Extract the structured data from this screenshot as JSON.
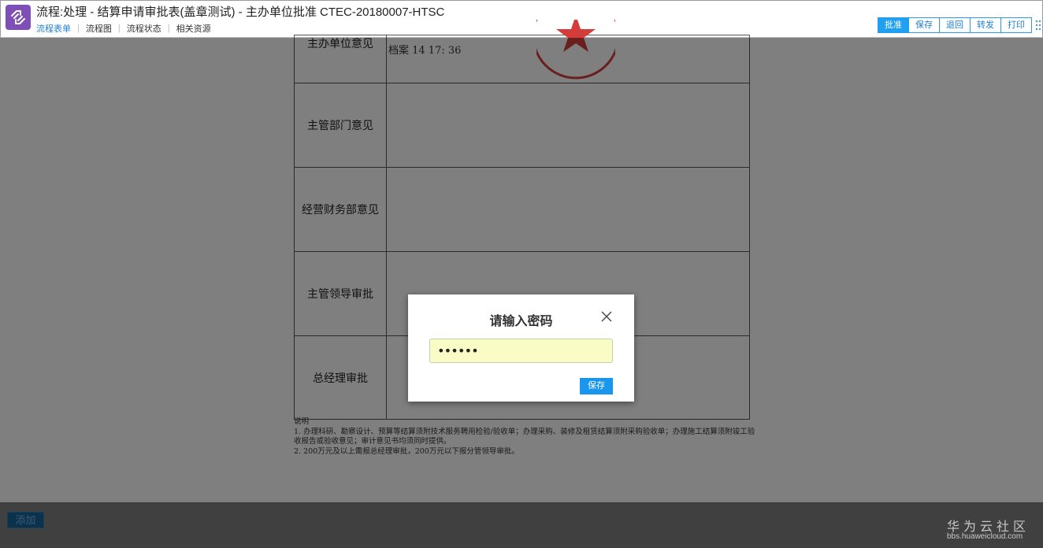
{
  "header": {
    "title": "流程:处理 - 结算申请审批表(盖章测试) - 主办单位批准 CTEC-20180007-HTSC",
    "nav": [
      {
        "label": "流程表单",
        "active": true
      },
      {
        "label": "流程图",
        "active": false
      },
      {
        "label": "流程状态",
        "active": false
      },
      {
        "label": "相关资源",
        "active": false
      }
    ],
    "toolbar": {
      "approve": "批准",
      "save": "保存",
      "return": "退回",
      "forward": "转发",
      "print": "打印"
    },
    "more_icon": "vertical-dots-icon",
    "logo_icon": "workflow-logo-icon",
    "accent_color": "#20a0f0"
  },
  "form": {
    "rows": [
      {
        "label": "主办单位意见",
        "signature": "档案   14 17:  36"
      },
      {
        "label": "主管部门意见"
      },
      {
        "label": "经营财务部意见"
      },
      {
        "label": "主管领导审批"
      },
      {
        "label": "总经理审批"
      }
    ],
    "notes": {
      "heading": "说明",
      "line1": "1. 办理科研、勘察设计、预算等结算须附技术服务聘用检验/验收单；办理采购、装修及租赁结算须附采购验收单；办理施工结算须附竣工验收报告或验收意见；审计意见书均须同时提供。",
      "line2": "2. 200万元及以上需报总经理审批，200万元以下报分管领导审批。"
    }
  },
  "footer": {
    "add_label": "添加",
    "watermark_cn": "华为云社区",
    "watermark_en": "bbs.huaweicloud.com"
  },
  "modal": {
    "title": "请输入密码",
    "password_value": "••••••",
    "save_label": "保存"
  }
}
